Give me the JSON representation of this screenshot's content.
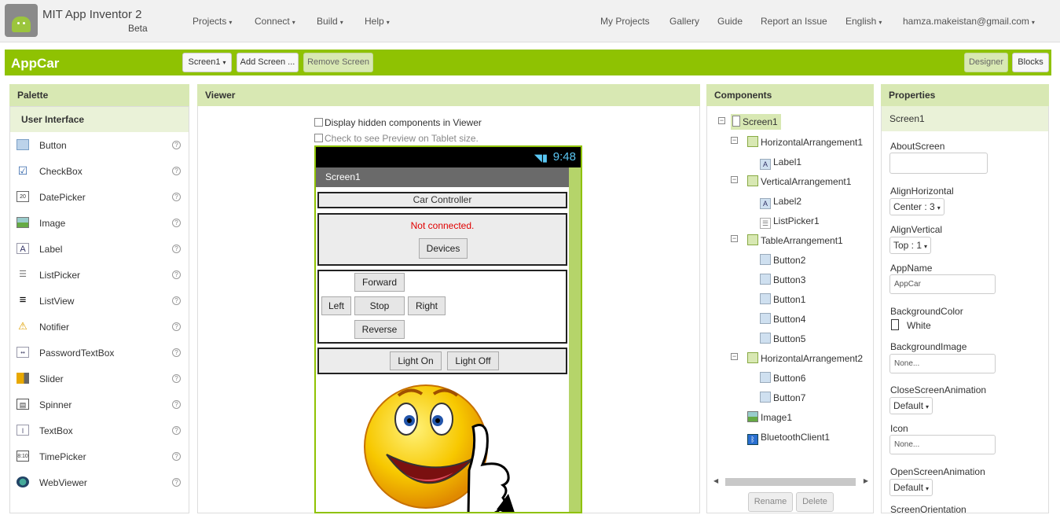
{
  "header": {
    "brand": "MIT App Inventor 2",
    "beta": "Beta",
    "nav_left": [
      "Projects",
      "Connect",
      "Build",
      "Help"
    ],
    "nav_right": [
      "My Projects",
      "Gallery",
      "Guide",
      "Report an Issue"
    ],
    "language": "English",
    "account": "hamza.makeistan@gmail.com"
  },
  "toolbar": {
    "project_name": "AppCar",
    "screen_select": "Screen1",
    "add_screen": "Add Screen ...",
    "remove_screen": "Remove Screen",
    "designer": "Designer",
    "blocks": "Blocks"
  },
  "palette": {
    "title": "Palette",
    "section": "User Interface",
    "items": [
      {
        "label": "Button",
        "icon": "button-icon"
      },
      {
        "label": "CheckBox",
        "icon": "checkbox-icon"
      },
      {
        "label": "DatePicker",
        "icon": "datepicker-icon"
      },
      {
        "label": "Image",
        "icon": "image-icon"
      },
      {
        "label": "Label",
        "icon": "label-icon"
      },
      {
        "label": "ListPicker",
        "icon": "listpicker-icon"
      },
      {
        "label": "ListView",
        "icon": "listview-icon"
      },
      {
        "label": "Notifier",
        "icon": "notifier-icon"
      },
      {
        "label": "PasswordTextBox",
        "icon": "passwordtextbox-icon"
      },
      {
        "label": "Slider",
        "icon": "slider-icon"
      },
      {
        "label": "Spinner",
        "icon": "spinner-icon"
      },
      {
        "label": "TextBox",
        "icon": "textbox-icon"
      },
      {
        "label": "TimePicker",
        "icon": "timepicker-icon"
      },
      {
        "label": "WebViewer",
        "icon": "webviewer-icon"
      }
    ],
    "help_glyph": "?"
  },
  "viewer": {
    "title": "Viewer",
    "show_hidden": "Display hidden components in Viewer",
    "tablet_preview": "Check to see Preview on Tablet size.",
    "phone": {
      "time": "9:48",
      "screen_title": "Screen1",
      "car_controller": "Car Controller",
      "status": "Not connected.",
      "devices": "Devices",
      "forward": "Forward",
      "left": "Left",
      "stop": "Stop",
      "right": "Right",
      "reverse": "Reverse",
      "light_on": "Light On",
      "light_off": "Light Off"
    }
  },
  "components": {
    "title": "Components",
    "tree": [
      "Screen1",
      "HorizontalArrangement1",
      "Label1",
      "VerticalArrangement1",
      "Label2",
      "ListPicker1",
      "TableArrangement1",
      "Button2",
      "Button3",
      "Button1",
      "Button4",
      "Button5",
      "HorizontalArrangement2",
      "Button6",
      "Button7",
      "Image1",
      "BluetoothClient1"
    ],
    "rename": "Rename",
    "delete": "Delete"
  },
  "properties": {
    "title": "Properties",
    "component": "Screen1",
    "about_screen_label": "AboutScreen",
    "align_horizontal_label": "AlignHorizontal",
    "align_horizontal_value": "Center : 3",
    "align_vertical_label": "AlignVertical",
    "align_vertical_value": "Top : 1",
    "app_name_label": "AppName",
    "app_name_value": "AppCar",
    "background_color_label": "BackgroundColor",
    "background_color_value": "White",
    "background_image_label": "BackgroundImage",
    "background_image_value": "None...",
    "close_anim_label": "CloseScreenAnimation",
    "close_anim_value": "Default",
    "icon_label": "Icon",
    "icon_value": "None...",
    "open_anim_label": "OpenScreenAnimation",
    "open_anim_value": "Default",
    "orientation_label": "ScreenOrientation"
  },
  "colors": {
    "accent": "#8fc202",
    "panel_header": "#d8e8b3",
    "status_red": "#e00000"
  }
}
